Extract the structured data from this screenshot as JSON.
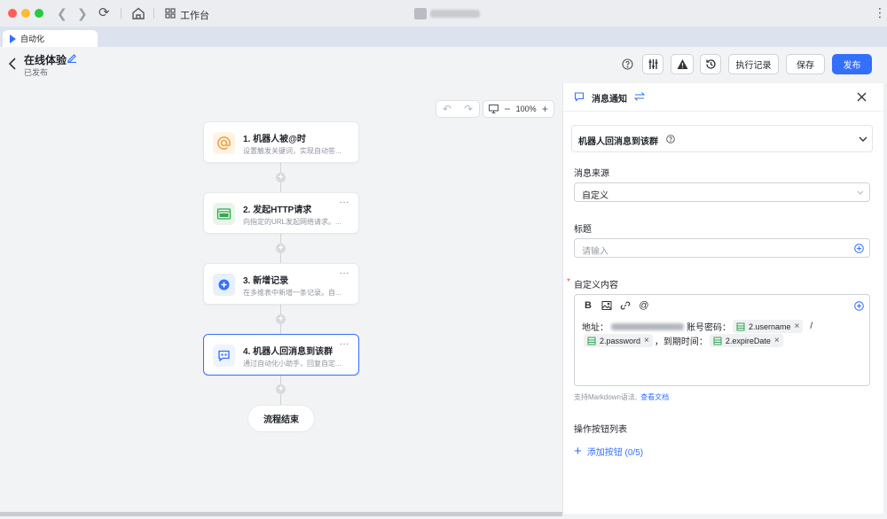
{
  "titlebar": {
    "workbench_label": "工作台"
  },
  "tab": {
    "label": "自动化"
  },
  "header": {
    "title": "在线体验",
    "status": "已发布",
    "runlog_label": "执行记录",
    "save_label": "保存",
    "publish_label": "发布"
  },
  "canvas": {
    "zoom": "100%",
    "nodes": [
      {
        "title": "1. 机器人被@时",
        "desc": "设置触发关键词，实现自动答...",
        "icon": "at-icon"
      },
      {
        "title": "2. 发起HTTP请求",
        "desc": "向指定的URL发起网络请求。...",
        "icon": "http-icon"
      },
      {
        "title": "3. 新增记录",
        "desc": "在多维表中新增一条记录。自...",
        "icon": "add-record-icon"
      },
      {
        "title": "4. 机器人回消息到该群",
        "desc": "通过自动化小助手，回复自定...",
        "icon": "message-icon"
      }
    ],
    "end_label": "流程结束"
  },
  "panel": {
    "title": "消息通知",
    "trigger": "机器人回消息到该群",
    "source_label": "消息来源",
    "source_value": "自定义",
    "title_label": "标题",
    "title_placeholder": "请输入",
    "content_label": "自定义内容",
    "content": {
      "address_prefix": "地址：",
      "account_prefix": "账号密码：",
      "chip_username": "2.username",
      "slash": "/",
      "chip_password": "2.password",
      "expire_prefix": "，到期时间：",
      "chip_expire": "2.expireDate"
    },
    "hint": "支持Markdown语法,",
    "hint_link": "查看文档",
    "buttons_label": "操作按钮列表",
    "add_button_label": "添加按钮 (0/5)"
  },
  "colors": {
    "accent": "#3370ff",
    "background": "#f2f3f5",
    "required": "#f54a45"
  }
}
